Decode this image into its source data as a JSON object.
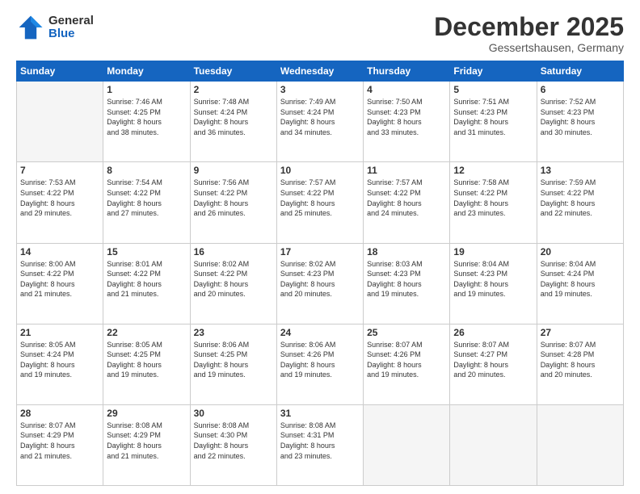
{
  "logo": {
    "line1": "General",
    "line2": "Blue"
  },
  "title": "December 2025",
  "location": "Gessertshausen, Germany",
  "days_of_week": [
    "Sunday",
    "Monday",
    "Tuesday",
    "Wednesday",
    "Thursday",
    "Friday",
    "Saturday"
  ],
  "weeks": [
    [
      {
        "day": "",
        "info": ""
      },
      {
        "day": "1",
        "info": "Sunrise: 7:46 AM\nSunset: 4:25 PM\nDaylight: 8 hours\nand 38 minutes."
      },
      {
        "day": "2",
        "info": "Sunrise: 7:48 AM\nSunset: 4:24 PM\nDaylight: 8 hours\nand 36 minutes."
      },
      {
        "day": "3",
        "info": "Sunrise: 7:49 AM\nSunset: 4:24 PM\nDaylight: 8 hours\nand 34 minutes."
      },
      {
        "day": "4",
        "info": "Sunrise: 7:50 AM\nSunset: 4:23 PM\nDaylight: 8 hours\nand 33 minutes."
      },
      {
        "day": "5",
        "info": "Sunrise: 7:51 AM\nSunset: 4:23 PM\nDaylight: 8 hours\nand 31 minutes."
      },
      {
        "day": "6",
        "info": "Sunrise: 7:52 AM\nSunset: 4:23 PM\nDaylight: 8 hours\nand 30 minutes."
      }
    ],
    [
      {
        "day": "7",
        "info": "Sunrise: 7:53 AM\nSunset: 4:22 PM\nDaylight: 8 hours\nand 29 minutes."
      },
      {
        "day": "8",
        "info": "Sunrise: 7:54 AM\nSunset: 4:22 PM\nDaylight: 8 hours\nand 27 minutes."
      },
      {
        "day": "9",
        "info": "Sunrise: 7:56 AM\nSunset: 4:22 PM\nDaylight: 8 hours\nand 26 minutes."
      },
      {
        "day": "10",
        "info": "Sunrise: 7:57 AM\nSunset: 4:22 PM\nDaylight: 8 hours\nand 25 minutes."
      },
      {
        "day": "11",
        "info": "Sunrise: 7:57 AM\nSunset: 4:22 PM\nDaylight: 8 hours\nand 24 minutes."
      },
      {
        "day": "12",
        "info": "Sunrise: 7:58 AM\nSunset: 4:22 PM\nDaylight: 8 hours\nand 23 minutes."
      },
      {
        "day": "13",
        "info": "Sunrise: 7:59 AM\nSunset: 4:22 PM\nDaylight: 8 hours\nand 22 minutes."
      }
    ],
    [
      {
        "day": "14",
        "info": "Sunrise: 8:00 AM\nSunset: 4:22 PM\nDaylight: 8 hours\nand 21 minutes."
      },
      {
        "day": "15",
        "info": "Sunrise: 8:01 AM\nSunset: 4:22 PM\nDaylight: 8 hours\nand 21 minutes."
      },
      {
        "day": "16",
        "info": "Sunrise: 8:02 AM\nSunset: 4:22 PM\nDaylight: 8 hours\nand 20 minutes."
      },
      {
        "day": "17",
        "info": "Sunrise: 8:02 AM\nSunset: 4:23 PM\nDaylight: 8 hours\nand 20 minutes."
      },
      {
        "day": "18",
        "info": "Sunrise: 8:03 AM\nSunset: 4:23 PM\nDaylight: 8 hours\nand 19 minutes."
      },
      {
        "day": "19",
        "info": "Sunrise: 8:04 AM\nSunset: 4:23 PM\nDaylight: 8 hours\nand 19 minutes."
      },
      {
        "day": "20",
        "info": "Sunrise: 8:04 AM\nSunset: 4:24 PM\nDaylight: 8 hours\nand 19 minutes."
      }
    ],
    [
      {
        "day": "21",
        "info": "Sunrise: 8:05 AM\nSunset: 4:24 PM\nDaylight: 8 hours\nand 19 minutes."
      },
      {
        "day": "22",
        "info": "Sunrise: 8:05 AM\nSunset: 4:25 PM\nDaylight: 8 hours\nand 19 minutes."
      },
      {
        "day": "23",
        "info": "Sunrise: 8:06 AM\nSunset: 4:25 PM\nDaylight: 8 hours\nand 19 minutes."
      },
      {
        "day": "24",
        "info": "Sunrise: 8:06 AM\nSunset: 4:26 PM\nDaylight: 8 hours\nand 19 minutes."
      },
      {
        "day": "25",
        "info": "Sunrise: 8:07 AM\nSunset: 4:26 PM\nDaylight: 8 hours\nand 19 minutes."
      },
      {
        "day": "26",
        "info": "Sunrise: 8:07 AM\nSunset: 4:27 PM\nDaylight: 8 hours\nand 20 minutes."
      },
      {
        "day": "27",
        "info": "Sunrise: 8:07 AM\nSunset: 4:28 PM\nDaylight: 8 hours\nand 20 minutes."
      }
    ],
    [
      {
        "day": "28",
        "info": "Sunrise: 8:07 AM\nSunset: 4:29 PM\nDaylight: 8 hours\nand 21 minutes."
      },
      {
        "day": "29",
        "info": "Sunrise: 8:08 AM\nSunset: 4:29 PM\nDaylight: 8 hours\nand 21 minutes."
      },
      {
        "day": "30",
        "info": "Sunrise: 8:08 AM\nSunset: 4:30 PM\nDaylight: 8 hours\nand 22 minutes."
      },
      {
        "day": "31",
        "info": "Sunrise: 8:08 AM\nSunset: 4:31 PM\nDaylight: 8 hours\nand 23 minutes."
      },
      {
        "day": "",
        "info": ""
      },
      {
        "day": "",
        "info": ""
      },
      {
        "day": "",
        "info": ""
      }
    ]
  ]
}
